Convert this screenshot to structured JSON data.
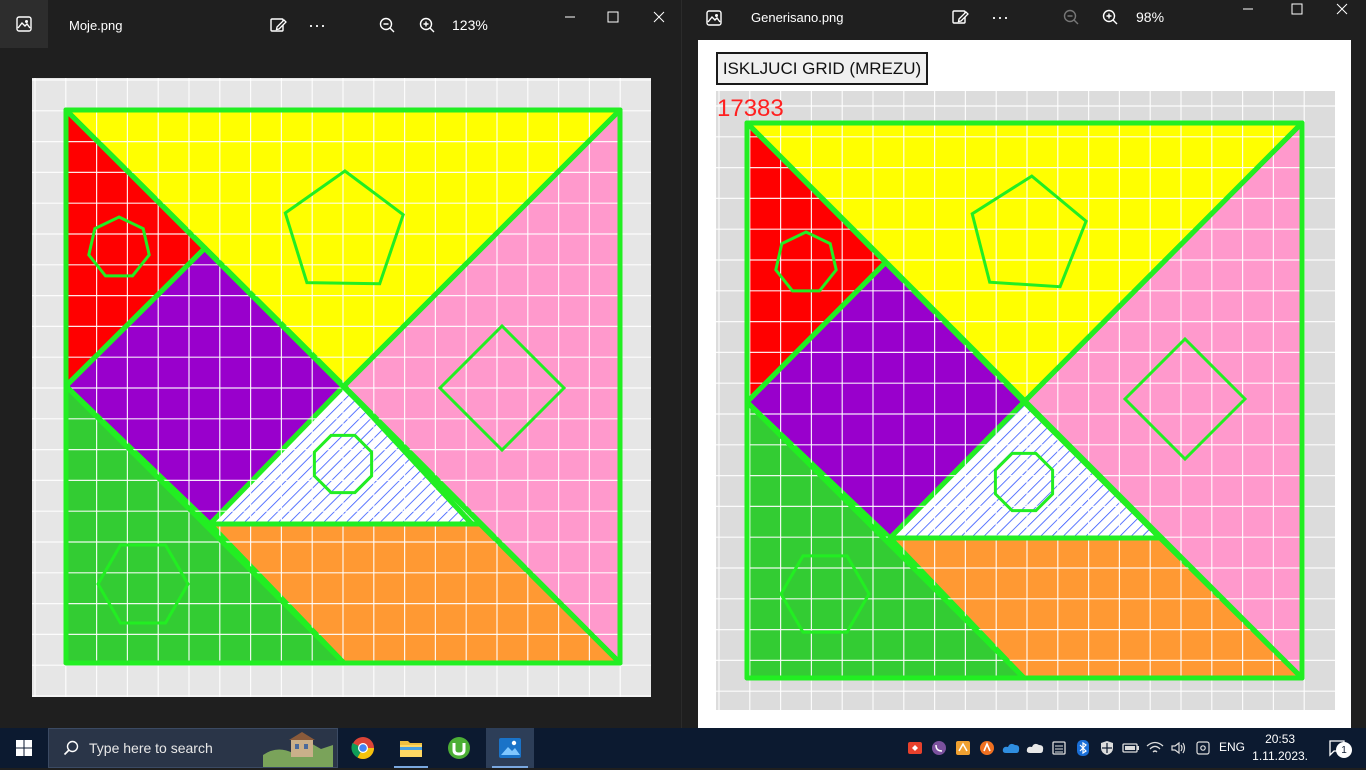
{
  "left_window": {
    "file_name": "Moje.png",
    "zoom": "123%"
  },
  "right_window": {
    "file_name": "Generisano.png",
    "zoom": "98%",
    "grid_button_label": "ISKLJUCI GRID (MREZU)",
    "counter": "17383"
  },
  "taskbar": {
    "search_placeholder": "Type here to search",
    "language": "ENG",
    "time": "20:53",
    "date": "1.11.2023.",
    "notification_count": "1"
  },
  "colors": {
    "outline": "#22ee22",
    "red_piece": "#ff0000",
    "yellow_piece": "#ffff00",
    "purple_piece": "#9900cc",
    "pink_piece": "#ff99cc",
    "green_piece": "#33cc33",
    "orange_piece": "#ff9933",
    "white_piece": "#ffffff",
    "hatch": "#3355ff"
  }
}
